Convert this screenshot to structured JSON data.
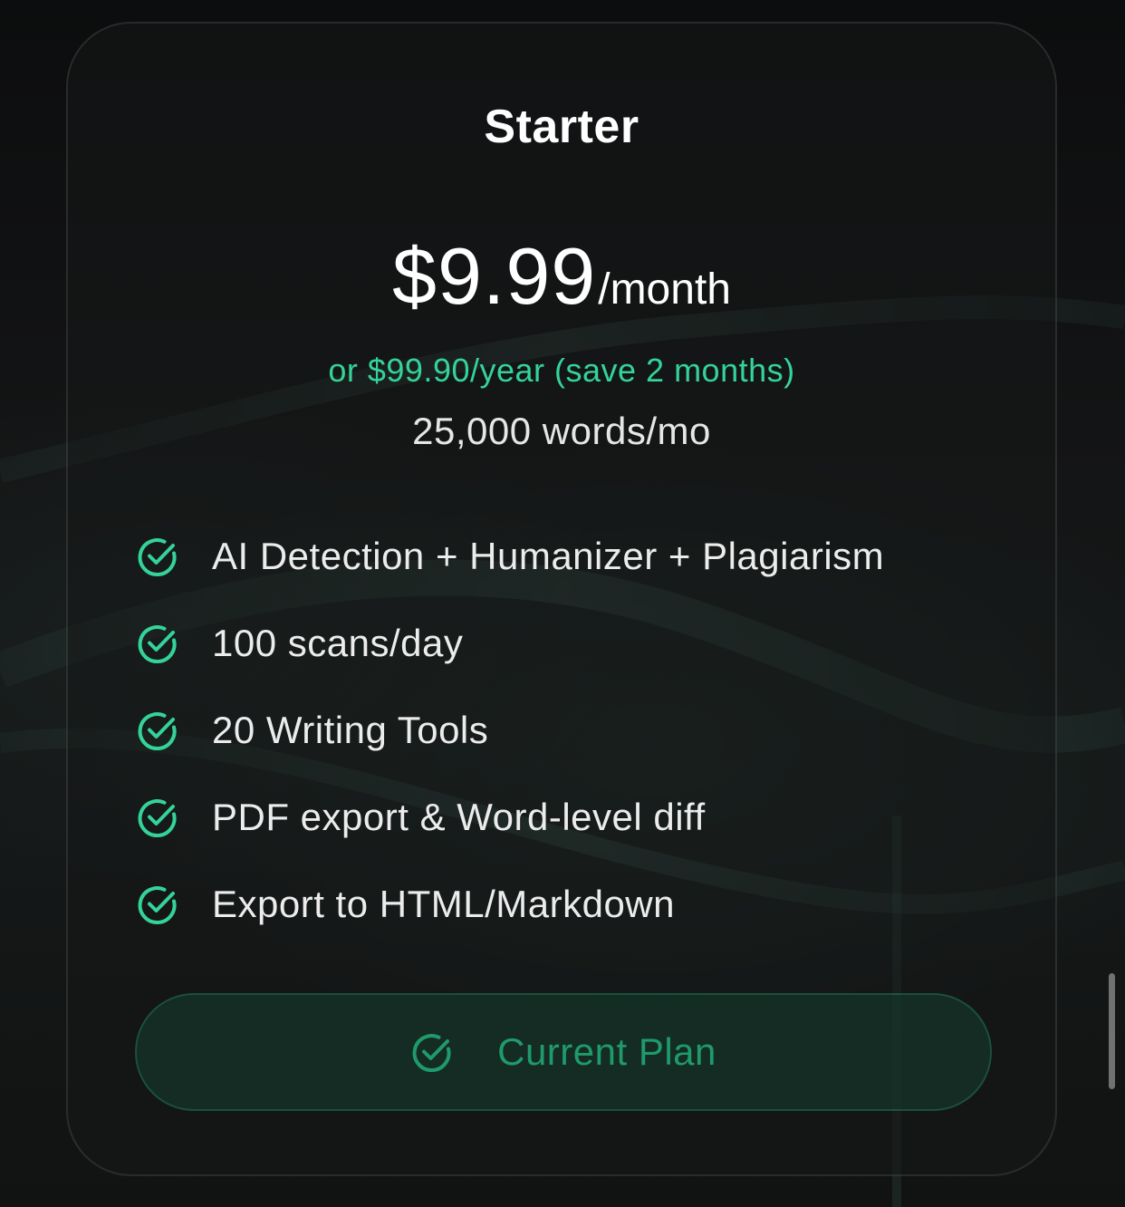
{
  "plan": {
    "title": "Starter",
    "price_amount": "$9.99",
    "price_period": "/month",
    "yearly_offer": "or $99.90/year (save 2 months)",
    "word_limit": "25,000 words/mo"
  },
  "features": [
    {
      "label": "AI Detection + Humanizer + Plagiarism",
      "icon": "check-circle-icon"
    },
    {
      "label": "100 scans/day",
      "icon": "check-circle-icon"
    },
    {
      "label": "20 Writing Tools",
      "icon": "check-circle-icon"
    },
    {
      "label": "PDF export & Word-level diff",
      "icon": "check-circle-icon"
    },
    {
      "label": "Export to HTML/Markdown",
      "icon": "check-circle-icon"
    }
  ],
  "cta": {
    "label": "Current Plan",
    "icon": "check-circle-icon"
  },
  "colors": {
    "accent": "#34d399",
    "cta_text": "#1f9a6c",
    "background": "#101112"
  }
}
